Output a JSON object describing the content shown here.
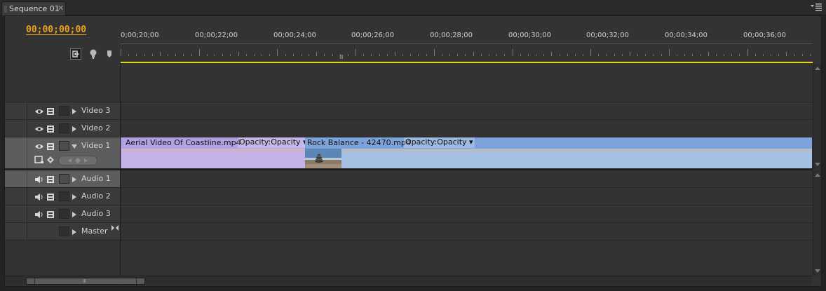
{
  "tab": {
    "title": "Sequence 01",
    "close": "✕"
  },
  "timecode": "00;00;00;00",
  "icons": {
    "snap": "snap-icon",
    "marker": "marker-icon",
    "menu": "panel-menu-icon",
    "eye": "eye-icon",
    "film": "film-icon",
    "speaker": "speaker-icon"
  },
  "ruler": {
    "labels": [
      "0;00;20;00",
      "00;00;22;00",
      "00;00;24;00",
      "00;00;26;00",
      "00;00;28;00",
      "00;00;30;00",
      "00;00;32;00",
      "00;00;34;00",
      "00;00;36;00"
    ]
  },
  "tracks": {
    "video": [
      {
        "name": "Video 3"
      },
      {
        "name": "Video 2"
      },
      {
        "name": "Video 1"
      }
    ],
    "audio": [
      {
        "name": "Audio 1"
      },
      {
        "name": "Audio 2"
      },
      {
        "name": "Audio 3"
      },
      {
        "name": "Master"
      }
    ]
  },
  "clips": [
    {
      "name": "Aerial Video Of Coastline.mp4",
      "effect": "Opacity:Opacity ▾",
      "color": "#c4b3e9"
    },
    {
      "name": "Rock Balance - 42470.mp4",
      "effect": "Opacity:Opacity ▾",
      "color": "#a5c0e3"
    }
  ],
  "accent": {
    "timecode": "#e9a31b",
    "workarea": "#e5d31c"
  }
}
